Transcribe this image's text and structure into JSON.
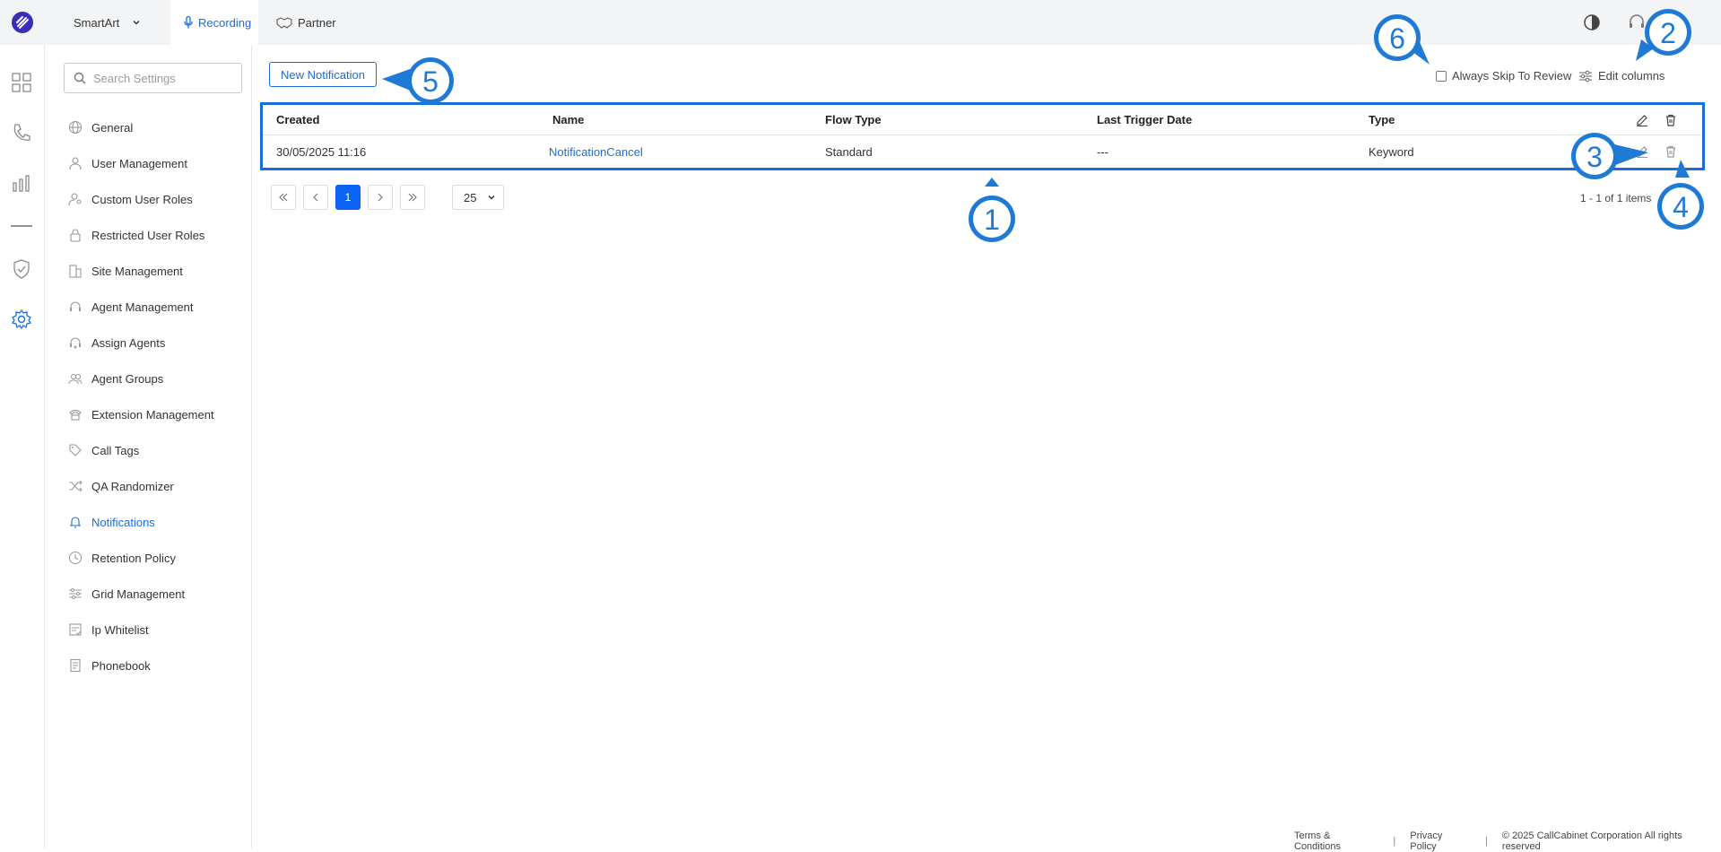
{
  "topbar": {
    "workspace": "SmartArt",
    "tabs": [
      {
        "label": "Recording",
        "active": true
      },
      {
        "label": "Partner",
        "active": false
      }
    ]
  },
  "search": {
    "placeholder": "Search Settings"
  },
  "sidebar": {
    "items": [
      {
        "label": "General",
        "icon": "globe-icon"
      },
      {
        "label": "User Management",
        "icon": "user-icon"
      },
      {
        "label": "Custom User Roles",
        "icon": "user-key-icon"
      },
      {
        "label": "Restricted User Roles",
        "icon": "lock-icon"
      },
      {
        "label": "Site Management",
        "icon": "building-icon"
      },
      {
        "label": "Agent Management",
        "icon": "headset-icon"
      },
      {
        "label": "Assign Agents",
        "icon": "headset-plus-icon"
      },
      {
        "label": "Agent Groups",
        "icon": "group-icon"
      },
      {
        "label": "Extension Management",
        "icon": "phone-icon"
      },
      {
        "label": "Call Tags",
        "icon": "tag-icon"
      },
      {
        "label": "QA Randomizer",
        "icon": "shuffle-icon"
      },
      {
        "label": "Notifications",
        "icon": "bell-icon",
        "active": true
      },
      {
        "label": "Retention Policy",
        "icon": "clock-icon"
      },
      {
        "label": "Grid Management",
        "icon": "sliders-icon"
      },
      {
        "label": "Ip Whitelist",
        "icon": "list-check-icon"
      },
      {
        "label": "Phonebook",
        "icon": "book-icon"
      }
    ]
  },
  "toolbar": {
    "new_label": "New Notification",
    "skip_label": "Always Skip To Review",
    "edit_columns_label": "Edit columns"
  },
  "grid": {
    "headers": [
      "Created",
      "Name",
      "Flow Type",
      "Last Trigger Date",
      "Type"
    ],
    "rows": [
      [
        "30/05/2025 11:16",
        "NotificationCancel",
        "Standard",
        "---",
        "Keyword"
      ]
    ]
  },
  "pager": {
    "current": "1",
    "page_size": "25",
    "summary": "1 - 1 of 1 items"
  },
  "callouts": [
    "1",
    "2",
    "3",
    "4",
    "5",
    "6"
  ],
  "footer": {
    "terms": "Terms & Conditions",
    "privacy": "Privacy Policy",
    "copyright": "© 2025 CallCabinet Corporation All rights reserved"
  },
  "colors": {
    "accent": "#1a6dd6",
    "callout": "#1f7ad6"
  }
}
